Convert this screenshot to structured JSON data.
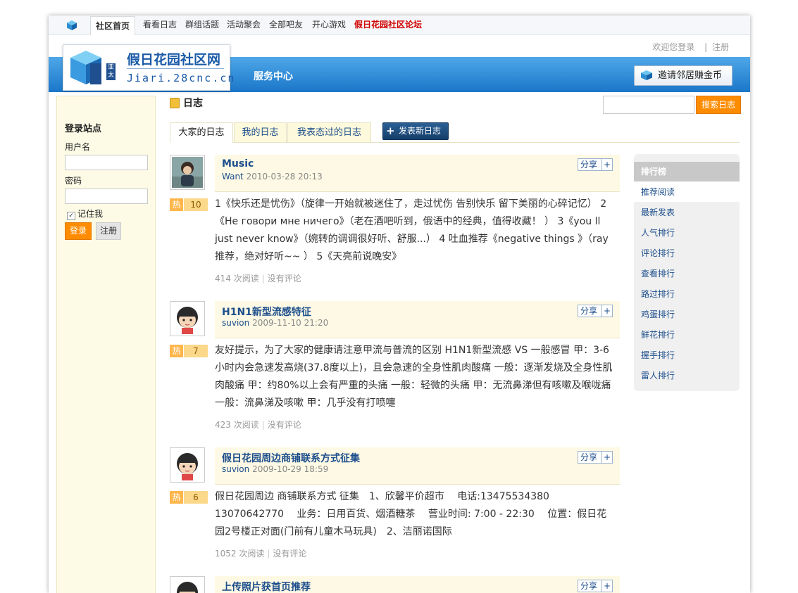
{
  "topnav": {
    "items": [
      {
        "label": "社区首页",
        "active": true
      },
      {
        "label": "看看日志"
      },
      {
        "label": "群组话题"
      },
      {
        "label": "活动聚会"
      },
      {
        "label": "全部吧友"
      },
      {
        "label": "开心游戏"
      },
      {
        "label": "假日花园社区论坛",
        "highlight": true
      }
    ]
  },
  "header": {
    "welcome_link": "欢迎您登录",
    "divider": "|",
    "register_link": "注册",
    "logo_title": "假日花园社区网",
    "logo_badge_top": "亚",
    "logo_badge_bottom": "太",
    "logo_url": "Jiari.28cnc.cn",
    "service_center": "服务中心",
    "invite_button": "邀请邻居赚金币"
  },
  "login": {
    "title": "登录站点",
    "username_label": "用户名",
    "password_label": "密码",
    "remember_label": "记住我",
    "remember_checked": true,
    "login_button": "登录",
    "register_button": "注册"
  },
  "main": {
    "page_title": "日志",
    "search_button": "搜索日志",
    "tabs": [
      {
        "label": "大家的日志",
        "active": true
      },
      {
        "label": "我的日志"
      },
      {
        "label": "我表态过的日志"
      }
    ],
    "new_post_button": "发表新日志"
  },
  "posts": [
    {
      "title": "Music",
      "author": "Want",
      "datetime": "2010-03-28 20:13",
      "hot_label": "热",
      "hot_value": "10",
      "share": "分享",
      "share_plus": "+",
      "body": "1《快乐还是忧伤》（旋律一开始就被迷住了，走过忧伤 告别快乐 留下美丽的心碎记忆） 2《Не говори мне ничего》（老在酒吧听到，俄语中的经典，值得收藏！ ） 3《you ll just never know》（婉转的调调很好听、舒服...） 4 吐血推荐《negative things 》（ray推荐，绝对好听~~ ） 5《天亮前说晚安》",
      "reads": "414 次阅读",
      "comments": "没有评论"
    },
    {
      "title": "H1N1新型流感特征",
      "author": "suvion",
      "datetime": "2009-11-10 21:20",
      "hot_label": "热",
      "hot_value": "7",
      "share": "分享",
      "share_plus": "+",
      "body": "友好提示，为了大家的健康请注意甲流与普流的区别 H1N1新型流感 VS 一般感冒 甲：3-6小时内会急速发高烧(37.8度以上)，且会急速的全身性肌肉酸痛 一般：逐渐发烧及全身性肌肉酸痛 甲：约80%以上会有严重的头痛 一般：轻微的头痛 甲：无流鼻涕但有咳嗽及喉咙痛 一般：流鼻涕及咳嗽 甲：几乎没有打喷嚏",
      "reads": "423 次阅读",
      "comments": "没有评论"
    },
    {
      "title": "假日花园周边商铺联系方式征集",
      "author": "suvion",
      "datetime": "2009-10-29 18:59",
      "hot_label": "热",
      "hot_value": "6",
      "share": "分享",
      "share_plus": "+",
      "body": "假日花园周边 商铺联系方式 征集　1、欣馨平价超市　 电话:13475534380　13070642770　 业务：日用百货、烟酒糖茶　 营业时间: 7:00 - 22:30　 位置：假日花园2号楼正对面(门前有儿童木马玩具)　2、洁丽诺国际",
      "reads": "1052 次阅读",
      "comments": "没有评论"
    },
    {
      "title": "上传照片获首页推荐",
      "share": "分享",
      "share_plus": "+"
    }
  ],
  "rank": {
    "title": "排行榜",
    "items": [
      "推荐阅读",
      "最新发表",
      "人气排行",
      "评论排行",
      "查看排行",
      "路过排行",
      "鸡蛋排行",
      "鲜花排行",
      "握手排行",
      "雷人排行"
    ]
  },
  "colors": {
    "accent_blue": "#1a76c9",
    "link_blue": "#1c4e8c",
    "orange_button": "#ff8c00",
    "highlight_red": "#d00000"
  }
}
